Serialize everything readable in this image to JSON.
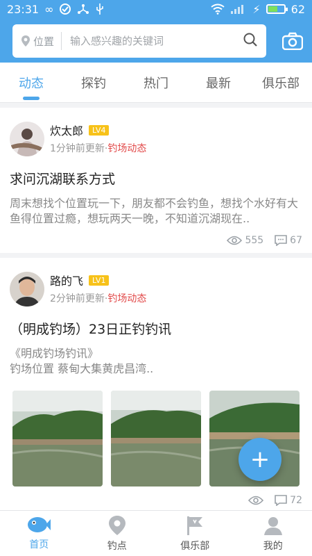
{
  "status_bar": {
    "time": "23:31",
    "battery_level": "62",
    "icons": [
      "infinity-icon",
      "check-circle-icon",
      "share-icon",
      "usb-icon",
      "wifi-icon",
      "signal-icon",
      "charging-icon",
      "battery-icon"
    ]
  },
  "search": {
    "location_label": "位置",
    "placeholder": "输入感兴趣的关键词"
  },
  "tabs": [
    {
      "label": "动态",
      "active": true
    },
    {
      "label": "探钓",
      "active": false
    },
    {
      "label": "热门",
      "active": false
    },
    {
      "label": "最新",
      "active": false
    },
    {
      "label": "俱乐部",
      "active": false
    }
  ],
  "posts": [
    {
      "author": "炊太郎",
      "level": "LV4",
      "time": "1分钟前更新",
      "separator": "·",
      "category": "钓场动态",
      "title": "求问沉湖联系方式",
      "body": "周末想找个位置玩一下，朋友都不会钓鱼，想找个水好有大鱼得位置过瘾，想玩两天一晚，不知道沉湖现在..",
      "views": "555",
      "comments": "67"
    },
    {
      "author": "路的飞",
      "level": "LV1",
      "time": "2分钟前更新",
      "separator": "·",
      "category": "钓场动态",
      "title": "（明成钓场）23日正钓钓讯",
      "body_line1": "《明成钓场钓讯》",
      "body_line2": "钓场位置 蔡甸大集黄虎昌湾..",
      "comments": "72"
    }
  ],
  "fab_label": "+",
  "bottom_nav": [
    {
      "label": "首页",
      "active": true
    },
    {
      "label": "钓点",
      "active": false
    },
    {
      "label": "俱乐部",
      "active": false
    },
    {
      "label": "我的",
      "active": false
    }
  ],
  "colors": {
    "accent": "#4da6ea",
    "category_red": "#e24a4a",
    "level_badge": "#f7c21a"
  }
}
